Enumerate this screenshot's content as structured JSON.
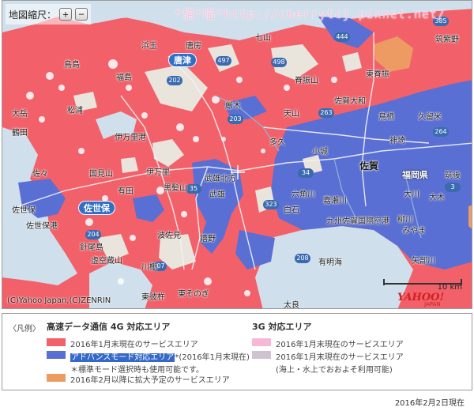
{
  "map": {
    "zoom_label": "地図縮尺：",
    "zoom_in": "+",
    "zoom_out": "−",
    "watermark": "*貓*喵*http://cherrytcj.pixnet.net/",
    "copyright": "(C)Yahoo Japan,(C)ZENRIN",
    "scale_label": "10 km",
    "logo": "YAHOO!",
    "logo_sub": "JAPAN",
    "colors": {
      "sea": "#cfe0ec",
      "area_4g": "#f2616a",
      "area_advanced": "#5a6fd3",
      "area_future": "#ee9a63",
      "land_uncovered": "#e9e4dc"
    },
    "places": [
      {
        "name": "唐房"
      },
      {
        "name": "唐津"
      },
      {
        "name": "鳥島"
      },
      {
        "name": "福島"
      },
      {
        "name": "大岳"
      },
      {
        "name": "松浦"
      },
      {
        "name": "鶴田"
      },
      {
        "name": "伊万里港"
      },
      {
        "name": "佐々"
      },
      {
        "name": "国見山"
      },
      {
        "name": "有田"
      },
      {
        "name": "伊万里"
      },
      {
        "name": "黒髪山"
      },
      {
        "name": "武雄"
      },
      {
        "name": "武雄北方"
      },
      {
        "name": "佐世保"
      },
      {
        "name": "佐世保港"
      },
      {
        "name": "針尾島"
      },
      {
        "name": "虚空蔵山"
      },
      {
        "name": "川棚"
      },
      {
        "name": "波佐見"
      },
      {
        "name": "嬉野"
      },
      {
        "name": "東彼杵"
      },
      {
        "name": "東そのぎ"
      },
      {
        "name": "天山"
      },
      {
        "name": "厳木"
      },
      {
        "name": "多久"
      },
      {
        "name": "小城"
      },
      {
        "name": "佐賀"
      },
      {
        "name": "六角川"
      },
      {
        "name": "白石"
      },
      {
        "name": "嘉瀬川"
      },
      {
        "name": "九州佐賀国際空港"
      },
      {
        "name": "有明海"
      },
      {
        "name": "太良"
      },
      {
        "name": "佐賀大和"
      },
      {
        "name": "鳥栖"
      },
      {
        "name": "久留米"
      },
      {
        "name": "筑紫野"
      },
      {
        "name": "大川"
      },
      {
        "name": "大木"
      },
      {
        "name": "柳川"
      },
      {
        "name": "みやま"
      },
      {
        "name": "矢部川"
      },
      {
        "name": "筑後"
      },
      {
        "name": "福岡県"
      },
      {
        "name": "神埼"
      },
      {
        "name": "吉野ヶ里"
      },
      {
        "name": "東脊振"
      },
      {
        "name": "筑紫野"
      },
      {
        "name": "脊振山"
      },
      {
        "name": "七山"
      },
      {
        "name": "浜玉"
      }
    ],
    "routes": [
      "497",
      "202",
      "203",
      "263",
      "204",
      "35",
      "34",
      "498",
      "207",
      "208",
      "444",
      "385",
      "323",
      "264",
      "3"
    ]
  },
  "legend": {
    "caption": "〈凡例〉",
    "col_4g": {
      "title": "高速データ通信 4G 対応エリア",
      "rows": [
        {
          "color": "#f2616a",
          "label": "2016年1月末現在のサービスエリア"
        },
        {
          "color": "#5a6fd3",
          "label_hl": "アドバンスモード対応エリア",
          "label": "*(2016年1月末現在)"
        },
        {
          "note": "＊標準モード選択時も使用可能です。"
        },
        {
          "color": "#ee9a63",
          "label": "2016年2月以降に拡大予定のサービスエリア"
        }
      ]
    },
    "col_3g": {
      "title": "3G 対応エリア",
      "rows": [
        {
          "color": "#f5b8d6",
          "label": "2016年1月末現在のサービスエリア"
        },
        {
          "color": "#cfc3cf",
          "label": "2016年1月末現在のサービスエリア"
        },
        {
          "note": "(海上・水上でおおよそ利用可能)"
        }
      ]
    }
  },
  "date": "2016年2月2日現在"
}
